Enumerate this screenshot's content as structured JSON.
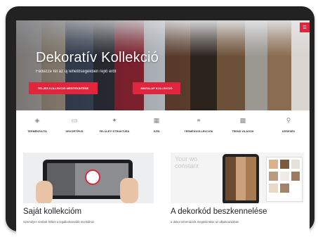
{
  "hero": {
    "title": "Dekoratív Kollekció",
    "subtitle": "Fedezze fel az új lehetőségekben rejlő erőt",
    "buttons": [
      {
        "label": "TELJES KOLLEKCIÓ MEGTEKINTÉSE"
      },
      {
        "label": "MINTALAP KOLLEKCIÓ"
      }
    ],
    "menu_icon": "menu-icon"
  },
  "nav": {
    "items": [
      {
        "label": "TERMÉKFAJTA",
        "icon": "product-type-icon"
      },
      {
        "label": "DEKORTÍPUS",
        "icon": "decor-type-icon"
      },
      {
        "label": "FELÜLETI STRUKTÚRA",
        "icon": "surface-structure-icon"
      },
      {
        "label": "SZÍN",
        "icon": "color-icon"
      },
      {
        "label": "TERMÉKKOLLEKCIÓK",
        "icon": "product-collections-icon"
      },
      {
        "label": "TREND VILÁGOK",
        "icon": "trend-worlds-icon"
      },
      {
        "label": "KERESÉS",
        "icon": "search-icon"
      }
    ]
  },
  "cards": [
    {
      "title": "Saját kollekcióm",
      "description": "Személyre szabott felület a legalkalmasabb munkához"
    },
    {
      "title": "A dekorkód beszkennelése",
      "description": "a dekor információk megtekintése az alkalmazásban"
    }
  ],
  "colors": {
    "accent": "#e1253d"
  }
}
